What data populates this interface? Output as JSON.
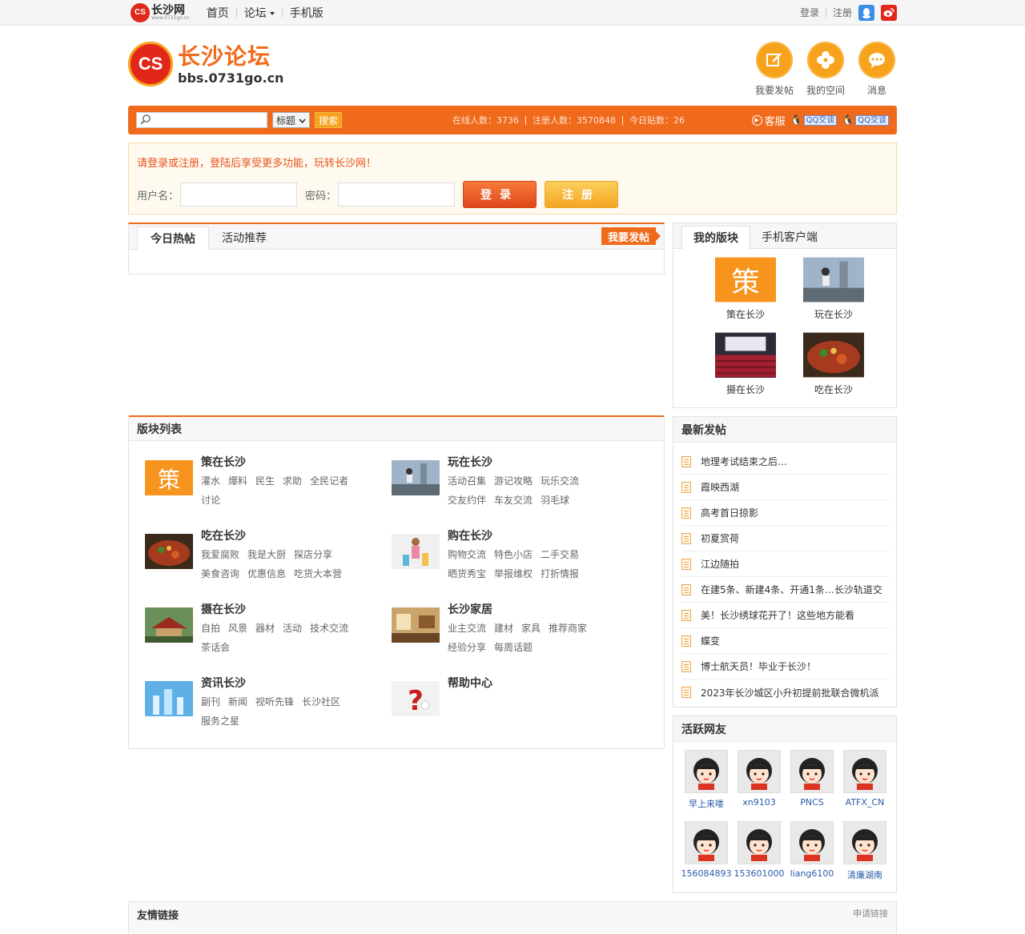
{
  "topbar": {
    "logo_text": "长沙网",
    "logo_sub": "www.0731go.cn",
    "nav": [
      {
        "label": "首页"
      },
      {
        "label": "论坛"
      },
      {
        "label": "手机版"
      }
    ],
    "login": "登录",
    "register": "注册"
  },
  "header": {
    "logo_title": "长沙论坛",
    "logo_domain": "bbs.0731go.cn",
    "buttons": [
      {
        "label": "我要发帖",
        "icon": "pencil-icon"
      },
      {
        "label": "我的空间",
        "icon": "flower-icon"
      },
      {
        "label": "消息",
        "icon": "chat-icon"
      }
    ]
  },
  "searchbar": {
    "select_value": "标题",
    "search_button": "搜索",
    "online": "在线人数：3736",
    "registered": "注册人数：3570848",
    "today_posts": "今日贴数：26",
    "kefu": "客服",
    "qq1": "QQ交谈",
    "qq2": "QQ交谈"
  },
  "login": {
    "tip": "请登录或注册，登陆后享受更多功能，玩转长沙网！",
    "username_label": "用户名：",
    "password_label": "密码：",
    "login_button": "登录",
    "register_button": "注册"
  },
  "hot": {
    "tabs": [
      {
        "label": "今日热帖"
      },
      {
        "label": "活动推荐"
      }
    ],
    "post_button": "我要发帖"
  },
  "forum_list": {
    "title": "版块列表",
    "forums": [
      {
        "name": "策在长沙",
        "links": [
          "灌水",
          "爆料",
          "民生",
          "求助",
          "全民记者",
          "讨论"
        ]
      },
      {
        "name": "玩在长沙",
        "links": [
          "活动召集",
          "游记攻略",
          "玩乐交流",
          "交友约伴",
          "车友交流",
          "羽毛球"
        ]
      },
      {
        "name": "吃在长沙",
        "links": [
          "我爱腐败",
          "我是大厨",
          "探店分享",
          "美食咨询",
          "优惠信息",
          "吃货大本营"
        ]
      },
      {
        "name": "购在长沙",
        "links": [
          "购物交流",
          "特色小店",
          "二手交易",
          "晒货秀宝",
          "举报维权",
          "打折情报"
        ]
      },
      {
        "name": "摄在长沙",
        "links": [
          "自拍",
          "风景",
          "器材",
          "活动",
          "技术交流",
          "茶话会"
        ]
      },
      {
        "name": "长沙家居",
        "links": [
          "业主交流",
          "建材",
          "家具",
          "推荐商家",
          "经验分享",
          "每周话题"
        ]
      },
      {
        "name": "资讯长沙",
        "links": [
          "副刊",
          "新闻",
          "视听先锋",
          "长沙社区",
          "服务之星"
        ]
      },
      {
        "name": "帮助中心",
        "links": []
      }
    ]
  },
  "my_boards": {
    "tabs": [
      {
        "label": "我的版块"
      },
      {
        "label": "手机客户端"
      }
    ],
    "boards": [
      {
        "label": "策在长沙"
      },
      {
        "label": "玩在长沙"
      },
      {
        "label": "摄在长沙"
      },
      {
        "label": "吃在长沙"
      }
    ]
  },
  "latest": {
    "title": "最新发帖",
    "posts": [
      "地理考试结束之后…",
      "霞映西湖",
      "高考首日掠影",
      "初夏赏荷",
      "江边随拍",
      "在建5条、新建4条、开通1条…长沙轨道交",
      "美！长沙绣球花开了！这些地方能看",
      "蝶变",
      "博士航天员！毕业于长沙！",
      "2023年长沙城区小升初提前批联合微机派"
    ]
  },
  "active": {
    "title": "活跃网友",
    "members": [
      "早上来喽",
      "xn9103",
      "PNCS",
      "ATFX_CN",
      "156084893",
      "153601000",
      "liang6100",
      "清廉湖南"
    ]
  },
  "footer": {
    "title": "友情链接",
    "apply": "申请链接"
  },
  "colors": {
    "accent": "#f06a1b",
    "yellow": "#f7a21b",
    "brand_red": "#e0271a"
  }
}
